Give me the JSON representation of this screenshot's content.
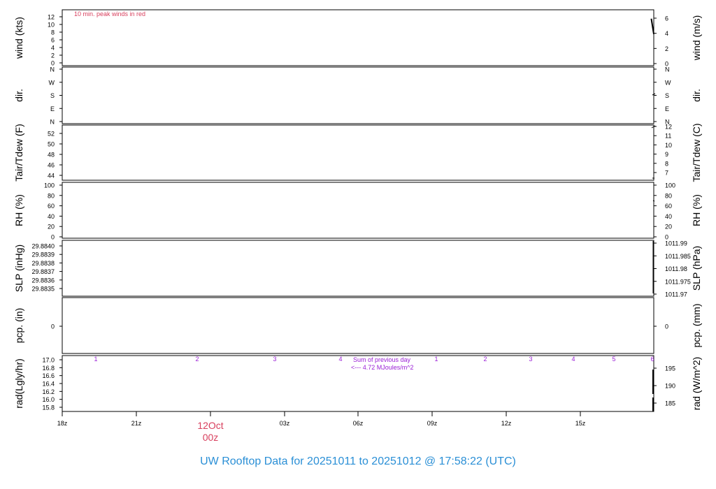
{
  "chart_data": {
    "type": "line",
    "title": "UW Rooftop Data for 20251011  to  20251012 @ 17:58:22  (UTC)",
    "x_axis": {
      "ticks": [
        "18z",
        "21z",
        "",
        "03z",
        "06z",
        "09z",
        "12z",
        "15z"
      ],
      "date_label": {
        "date": "12Oct",
        "time": "00z"
      }
    },
    "panels": [
      {
        "key": "wind",
        "left_label": "wind (kts)",
        "right_label": "wind (m/s)",
        "left_ticks": [
          "12",
          "10",
          "8",
          "6",
          "4",
          "2",
          "0"
        ],
        "right_ticks": [
          "6",
          "4",
          "2",
          "0"
        ],
        "left_range": [
          0,
          12
        ],
        "right_range": [
          0,
          6
        ],
        "annotation": "10 min. peak winds in red",
        "series": [
          {
            "x": [
              23.9,
              24.0
            ],
            "y": [
              11.5,
              7.5
            ]
          }
        ]
      },
      {
        "key": "dir",
        "left_label": "dir.",
        "right_label": "dir.",
        "left_ticks": [
          "N",
          "W",
          "S",
          "E",
          "N"
        ],
        "right_ticks": [
          "N",
          "W",
          "S",
          "E",
          "N"
        ]
      },
      {
        "key": "temp",
        "left_label": "Tair/Tdew (F)",
        "right_label": "Tair/Tdew (C)",
        "left_ticks": [
          "52",
          "50",
          "48",
          "46",
          "44"
        ],
        "right_ticks": [
          "12",
          "11",
          "10",
          "9",
          "8",
          "7"
        ]
      },
      {
        "key": "rh",
        "left_label": "RH (%)",
        "right_label": "RH (%)",
        "left_ticks": [
          "100",
          "80",
          "60",
          "40",
          "20",
          "0"
        ],
        "right_ticks": [
          "100",
          "80",
          "60",
          "40",
          "20",
          "0"
        ]
      },
      {
        "key": "slp",
        "left_label": "SLP (inHg)",
        "right_label": "SLP (hPa)",
        "left_ticks": [
          "29.8840",
          "29.8839",
          "29.8838",
          "29.8837",
          "29.8836",
          "29.8835"
        ],
        "right_ticks": [
          "1011.99",
          "1011.985",
          "1011.98",
          "1011.975",
          "1011.97"
        ]
      },
      {
        "key": "pcp",
        "left_label": "pcp. (in)",
        "right_label": "pcp. (mm)",
        "left_ticks": [
          "0"
        ],
        "right_ticks": [
          "0"
        ]
      },
      {
        "key": "rad",
        "left_label": "rad(Lgly/hr)",
        "right_label": "rad (W/m^2)",
        "left_ticks": [
          "17.0",
          "16.8",
          "16.6",
          "16.4",
          "16.2",
          "16.0",
          "15.8"
        ],
        "right_ticks": [
          "195",
          "190",
          "185"
        ],
        "hour_marks": [
          "1",
          "2",
          "3",
          "4",
          "1",
          "2",
          "3",
          "4",
          "5",
          "6"
        ],
        "note_line1": "Sum of previous day",
        "note_line2": "<--- 4.72 MJoules/m^2"
      }
    ]
  },
  "colors": {
    "title": "#2a8fd6",
    "date_label": "#d8405e",
    "annotation": "#d8405e",
    "radiation_text": "#9a1fd6",
    "axes": "#000000"
  }
}
